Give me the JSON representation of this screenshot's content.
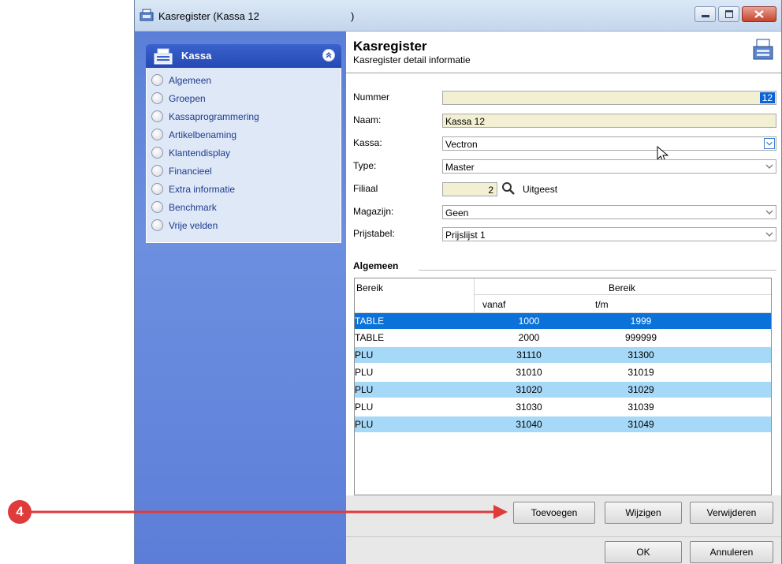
{
  "window": {
    "title": "Kasregister  (Kassa 12",
    "title_suffix": ")"
  },
  "sidebar": {
    "panel_title": "Kassa",
    "items": [
      {
        "label": "Algemeen"
      },
      {
        "label": "Groepen"
      },
      {
        "label": "Kassaprogrammering"
      },
      {
        "label": "Artikelbenaming"
      },
      {
        "label": "Klantendisplay"
      },
      {
        "label": "Financieel"
      },
      {
        "label": "Extra informatie"
      },
      {
        "label": "Benchmark"
      },
      {
        "label": "Vrije velden"
      }
    ]
  },
  "header": {
    "title": "Kasregister",
    "subtitle": "Kasregister detail informatie"
  },
  "form": {
    "nummer_label": "Nummer",
    "nummer_value": "12",
    "naam_label": "Naam:",
    "naam_value": "Kassa 12",
    "kassa_label": "Kassa:",
    "kassa_value": "Vectron",
    "type_label": "Type:",
    "type_value": "Master",
    "filiaal_label": "Filiaal",
    "filiaal_value": "2",
    "filiaal_name": "Uitgeest",
    "magazijn_label": "Magazijn:",
    "magazijn_value": "Geen",
    "prijstabel_label": "Prijstabel:",
    "prijstabel_value": "Prijslijst 1"
  },
  "section": {
    "title": "Algemeen"
  },
  "table": {
    "col_bereik": "Bereik",
    "group_bereik": "Bereik",
    "col_vanaf": "vanaf",
    "col_tm": "t/m",
    "rows": [
      {
        "type": "TABLE",
        "vanaf": "1000",
        "tm": "1999"
      },
      {
        "type": "TABLE",
        "vanaf": "2000",
        "tm": "999999"
      },
      {
        "type": "PLU",
        "vanaf": "31110",
        "tm": "31300"
      },
      {
        "type": "PLU",
        "vanaf": "31010",
        "tm": "31019"
      },
      {
        "type": "PLU",
        "vanaf": "31020",
        "tm": "31029"
      },
      {
        "type": "PLU",
        "vanaf": "31030",
        "tm": "31039"
      },
      {
        "type": "PLU",
        "vanaf": "31040",
        "tm": "31049"
      }
    ]
  },
  "buttons": {
    "toevoegen": "Toevoegen",
    "wijzigen": "Wijzigen",
    "verwijderen": "Verwijderen",
    "ok": "OK",
    "annuleren": "Annuleren"
  },
  "annotation": {
    "badge": "4"
  },
  "colors": {
    "sidebar": "#6384dc",
    "selected_row": "#0a72d8",
    "alt_row": "#a6d8f7",
    "field_yellow": "#f2efd2",
    "annotation_red": "#e03b3b"
  }
}
